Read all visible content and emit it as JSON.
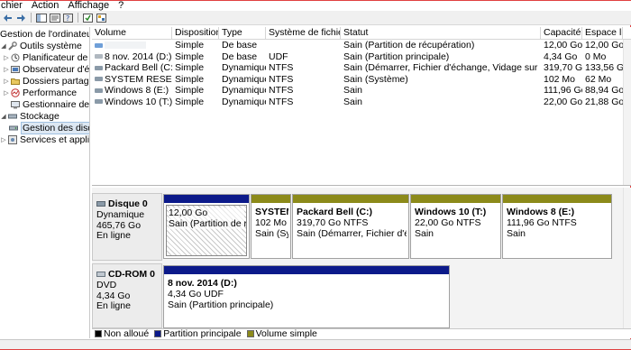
{
  "menu": [
    "chier",
    "Action",
    "Affichage",
    "?"
  ],
  "toolbar": [
    "back-icon",
    "forward-icon",
    "console-tree-icon",
    "properties-icon",
    "help-icon",
    "disk-props-icon",
    "refresh-icon"
  ],
  "tree": {
    "root": "Gestion de l'ordinateur (l",
    "nodes": [
      {
        "label": "Outils système",
        "icon": "tools-icon",
        "level": 0,
        "expanded": true
      },
      {
        "label": "Planificateur de tâc",
        "icon": "clock-icon",
        "level": 1
      },
      {
        "label": "Observateur d'évér",
        "icon": "event-viewer-icon",
        "level": 1
      },
      {
        "label": "Dossiers partagés",
        "icon": "shared-folder-icon",
        "level": 1
      },
      {
        "label": "Performance",
        "icon": "performance-icon",
        "level": 1
      },
      {
        "label": "Gestionnaire de pé",
        "icon": "device-manager-icon",
        "level": 1
      },
      {
        "label": "Stockage",
        "icon": "storage-icon",
        "level": 0,
        "expanded": true
      },
      {
        "label": "Gestion des disque",
        "icon": "disk-management-icon",
        "level": 1,
        "selected": true
      },
      {
        "label": "Services et application",
        "icon": "services-icon",
        "level": 0
      }
    ]
  },
  "volume_list": {
    "columns": [
      "Volume",
      "Disposition",
      "Type",
      "Système de fichiers",
      "Statut",
      "Capacité",
      "Espace libre"
    ],
    "rows": [
      {
        "volume": "",
        "disposition": "Simple",
        "type": "De base",
        "fs": "",
        "status": "Sain (Partition de récupération)",
        "capacity": "12,00 Go",
        "free": "12,00 Go",
        "icon": "blue"
      },
      {
        "volume": "8 nov. 2014 (D:)",
        "disposition": "Simple",
        "type": "De base",
        "fs": "UDF",
        "status": "Sain (Partition principale)",
        "capacity": "4,34 Go",
        "free": "0 Mo",
        "icon": "cd"
      },
      {
        "volume": "Packard Bell (C:)",
        "disposition": "Simple",
        "type": "Dynamique",
        "fs": "NTFS",
        "status": "Sain (Démarrer, Fichier d'échange, Vidage sur incident)",
        "capacity": "319,70 Go",
        "free": "133,56 Go",
        "icon": "disk"
      },
      {
        "volume": "SYSTEM RESERVED",
        "disposition": "Simple",
        "type": "Dynamique",
        "fs": "NTFS",
        "status": "Sain (Système)",
        "capacity": "102 Mo",
        "free": "62 Mo",
        "icon": "disk"
      },
      {
        "volume": "Windows 8 (E:)",
        "disposition": "Simple",
        "type": "Dynamique",
        "fs": "NTFS",
        "status": "Sain",
        "capacity": "111,96 Go",
        "free": "88,94 Go",
        "icon": "disk"
      },
      {
        "volume": "Windows 10 (T:)",
        "disposition": "Simple",
        "type": "Dynamique",
        "fs": "NTFS",
        "status": "Sain",
        "capacity": "22,00 Go",
        "free": "21,88 Go",
        "icon": "disk"
      }
    ]
  },
  "disks": [
    {
      "title": "Disque 0",
      "type": "Dynamique",
      "size": "465,76 Go",
      "state": "En ligne",
      "partitions": [
        {
          "title": "",
          "size": "12,00 Go",
          "status": "Sain (Partition de récu",
          "bar": "blue",
          "hatched": true
        },
        {
          "title": "SYSTEM I",
          "size": "102 Mo N",
          "status": "Sain (Syst",
          "bar": "olive"
        },
        {
          "title": "Packard Bell  (C:)",
          "size": "319,70 Go NTFS",
          "status": "Sain (Démarrer, Fichier d'échan",
          "bar": "olive"
        },
        {
          "title": "Windows 10  (T:)",
          "size": "22,00 Go NTFS",
          "status": "Sain",
          "bar": "olive"
        },
        {
          "title": "Windows 8  (E:)",
          "size": "111,96 Go NTFS",
          "status": "Sain",
          "bar": "olive"
        }
      ]
    },
    {
      "title": "CD-ROM 0",
      "type": "DVD",
      "size": "4,34 Go",
      "state": "En ligne",
      "partitions": [
        {
          "title": "8 nov. 2014  (D:)",
          "size": "4,34 Go UDF",
          "status": "Sain (Partition principale)",
          "bar": "blue"
        }
      ]
    }
  ],
  "legend": [
    {
      "label": "Non alloué",
      "color": "#000000"
    },
    {
      "label": "Partition principale",
      "color": "#0c1a8a"
    },
    {
      "label": "Volume simple",
      "color": "#8c8a1a"
    }
  ]
}
